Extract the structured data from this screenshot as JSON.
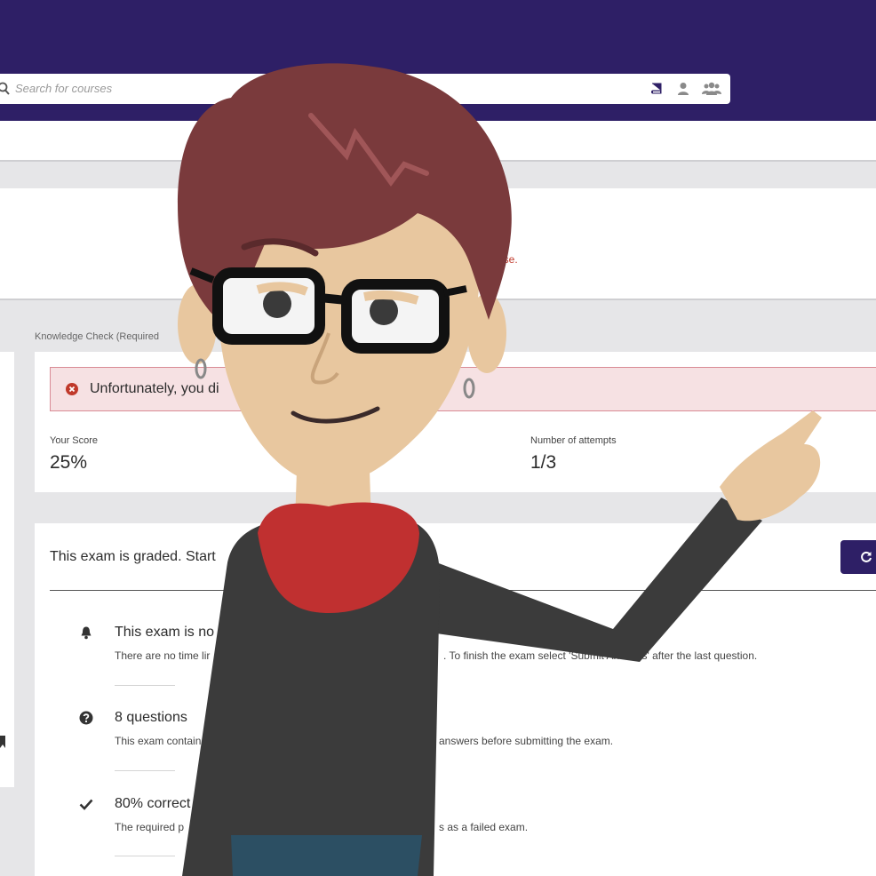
{
  "search": {
    "placeholder": "Search for courses"
  },
  "header_icons": [
    "book-icon",
    "user-icon",
    "users-icon"
  ],
  "banner": {
    "fragment": "urse."
  },
  "breadcrumb": "Knowledge Check (Required",
  "result": {
    "alert_text": "Unfortunately, you di",
    "score_label": "Your Score",
    "score_value": "25%",
    "attempts_label": "Number of attempts",
    "attempts_value": "1/3"
  },
  "exam": {
    "title": "This exam is graded. Start",
    "items": [
      {
        "icon": "bell-icon",
        "title": "This exam is no",
        "desc_a": "There are no time lir",
        "desc_b": ". To finish the exam select 'Submit Answers' after the last question."
      },
      {
        "icon": "question-circle-icon",
        "title": "8 questions",
        "desc_a": "This exam contain",
        "desc_b": "answers before submitting the exam."
      },
      {
        "icon": "check-icon",
        "title": "80% correct",
        "desc_a": "The required p",
        "desc_b": "s as a failed exam."
      }
    ]
  },
  "colors": {
    "brand": "#2e1f66",
    "alert_bg": "#f6e1e3",
    "alert_border": "#d98b95",
    "error": "#c0392b"
  }
}
